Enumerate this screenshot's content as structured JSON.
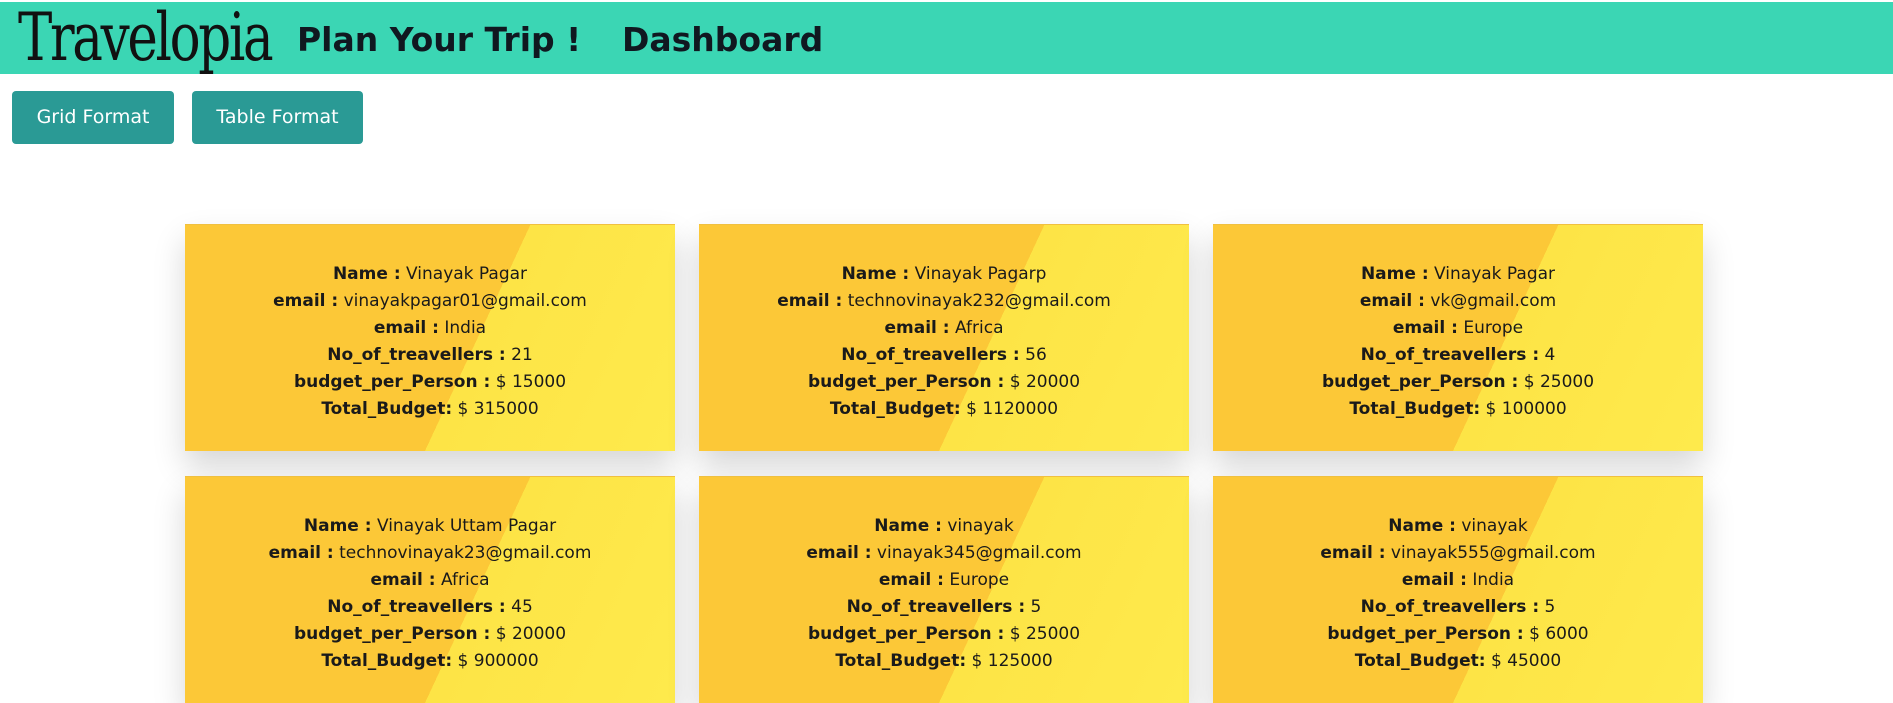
{
  "navbar": {
    "logo": "Travelopia",
    "links": [
      "Plan Your Trip !",
      "Dashboard"
    ],
    "color": "#3bd6b4"
  },
  "format_buttons": {
    "grid_label": "Grid Format",
    "table_label": "Table Format",
    "color": "#2a9a95"
  },
  "labels": {
    "name": "Name :",
    "email": "email :",
    "destination": "email :",
    "travellers": "No_of_treavellers :",
    "budget_per_person": "budget_per_Person :",
    "total_budget": "Total_Budget:"
  },
  "currency": "$",
  "cards": [
    {
      "name": "Vinayak Pagar",
      "email": "vinayakpagar01@gmail.com",
      "destination": "India",
      "travellers": "21",
      "budget_per_person": "15000",
      "total_budget": "315000"
    },
    {
      "name": "Vinayak Pagarp",
      "email": "technovinayak232@gmail.com",
      "destination": "Africa",
      "travellers": "56",
      "budget_per_person": "20000",
      "total_budget": "1120000"
    },
    {
      "name": "Vinayak Pagar",
      "email": "vk@gmail.com",
      "destination": "Europe",
      "travellers": "4",
      "budget_per_person": "25000",
      "total_budget": "100000"
    },
    {
      "name": "Vinayak Uttam Pagar",
      "email": "technovinayak23@gmail.com",
      "destination": "Africa",
      "travellers": "45",
      "budget_per_person": "20000",
      "total_budget": "900000"
    },
    {
      "name": "vinayak",
      "email": "vinayak345@gmail.com",
      "destination": "Europe",
      "travellers": "5",
      "budget_per_person": "25000",
      "total_budget": "125000"
    },
    {
      "name": "vinayak",
      "email": "vinayak555@gmail.com",
      "destination": "India",
      "travellers": "5",
      "budget_per_person": "6000",
      "total_budget": "45000"
    }
  ],
  "card_colors": {
    "dark": "#fcc837",
    "light": "#fde446"
  }
}
